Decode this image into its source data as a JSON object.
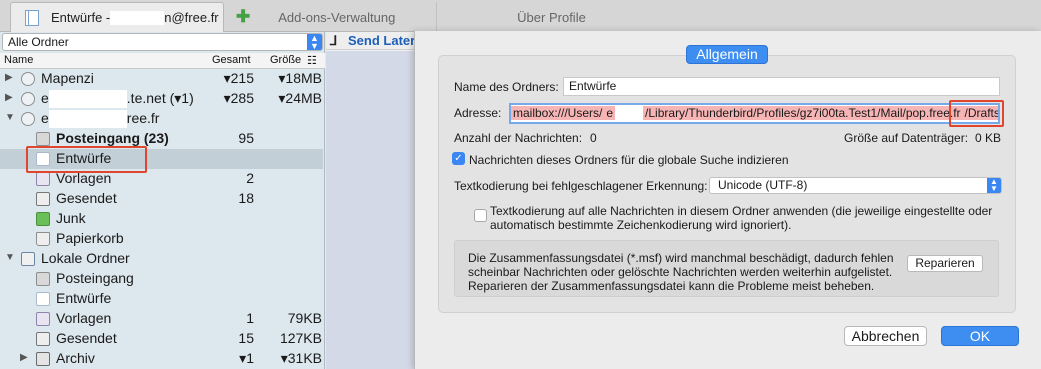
{
  "tabs": {
    "drafts_label": "Entwürfe - ",
    "drafts_email_suffix": "n@free.fr",
    "addons_label": "Add-ons-Verwaltung",
    "profile_label": "Über Profile"
  },
  "folder_pane": {
    "filter": "Alle Ordner",
    "columns": {
      "name": "Name",
      "total": "Gesamt",
      "size": "Größe"
    },
    "rows": [
      {
        "name": "Mapenzi",
        "total": "▾215",
        "size": "▾18MB",
        "icon": "account-icon"
      },
      {
        "name": "e",
        "name_suffix": ".te.net (▾1)",
        "total": "▾285",
        "size": "▾24MB",
        "icon": "account-icon"
      },
      {
        "name": "e",
        "name_suffix": "ree.fr",
        "total": "",
        "size": "",
        "icon": "account-icon"
      },
      {
        "name": "Posteingang (23)",
        "total": "95",
        "size": "",
        "icon": "inbox-icon"
      },
      {
        "name": "Entwürfe",
        "total": "",
        "size": "",
        "icon": "drafts-icon"
      },
      {
        "name": "Vorlagen",
        "total": "2",
        "size": "",
        "icon": "templates-icon"
      },
      {
        "name": "Gesendet",
        "total": "18",
        "size": "",
        "icon": "sent-icon"
      },
      {
        "name": "Junk",
        "total": "",
        "size": "",
        "icon": "junk-icon"
      },
      {
        "name": "Papierkorb",
        "total": "",
        "size": "",
        "icon": "trash-icon"
      },
      {
        "name": "Lokale Ordner",
        "total": "",
        "size": "",
        "icon": "local-folders-icon"
      },
      {
        "name": "Posteingang",
        "total": "",
        "size": "",
        "icon": "inbox-icon"
      },
      {
        "name": "Entwürfe",
        "total": "",
        "size": "",
        "icon": "drafts-icon"
      },
      {
        "name": "Vorlagen",
        "total": "1",
        "size": "79KB",
        "icon": "templates-icon"
      },
      {
        "name": "Gesendet",
        "total": "15",
        "size": "127KB",
        "icon": "sent-icon"
      },
      {
        "name": "Archiv",
        "total": "▾1",
        "size": "▾31KB",
        "icon": "archive-icon"
      }
    ]
  },
  "thread_toolbar": {
    "send_later": "Send Later"
  },
  "dialog": {
    "tab": "Allgemein",
    "folder_name_label": "Name des Ordners:",
    "folder_name_value": "Entwürfe",
    "address_label": "Adresse:",
    "address_part1": "mailbox:///Users/",
    "address_part1b": "e",
    "address_part2": "/Library/Thunderbird/Profiles/gz7i00ta.Test1/Mail/pop.free.fr",
    "address_part3": "/Drafts/",
    "message_count_label": "Anzahl der Nachrichten:",
    "message_count_value": "0",
    "disk_size_label": "Größe auf Datenträger:",
    "disk_size_value": "0 KB",
    "index_checkbox_label": "Nachrichten dieses Ordners für die globale Suche indizieren",
    "index_checked": true,
    "encoding_label": "Textkodierung bei fehlgeschlagener Erkennung:",
    "encoding_value": "Unicode (UTF-8)",
    "apply_encoding_line1": "Textkodierung auf alle Nachrichten in diesem Ordner anwenden (die jeweilige eingestellte oder",
    "apply_encoding_line2": "automatisch bestimmte Zeichenkodierung wird ignoriert).",
    "apply_encoding_checked": false,
    "repair_line1": "Die Zusammenfassungsdatei (*.msf) wird manchmal beschädigt, dadurch fehlen",
    "repair_line2": "scheinbar Nachrichten oder gelöschte Nachrichten werden weiterhin aufgelistet.",
    "repair_line3": "Reparieren der Zusammenfassungsdatei kann die Probleme meist beheben.",
    "repair_button": "Reparieren",
    "cancel_button": "Abbrechen",
    "ok_button": "OK"
  }
}
